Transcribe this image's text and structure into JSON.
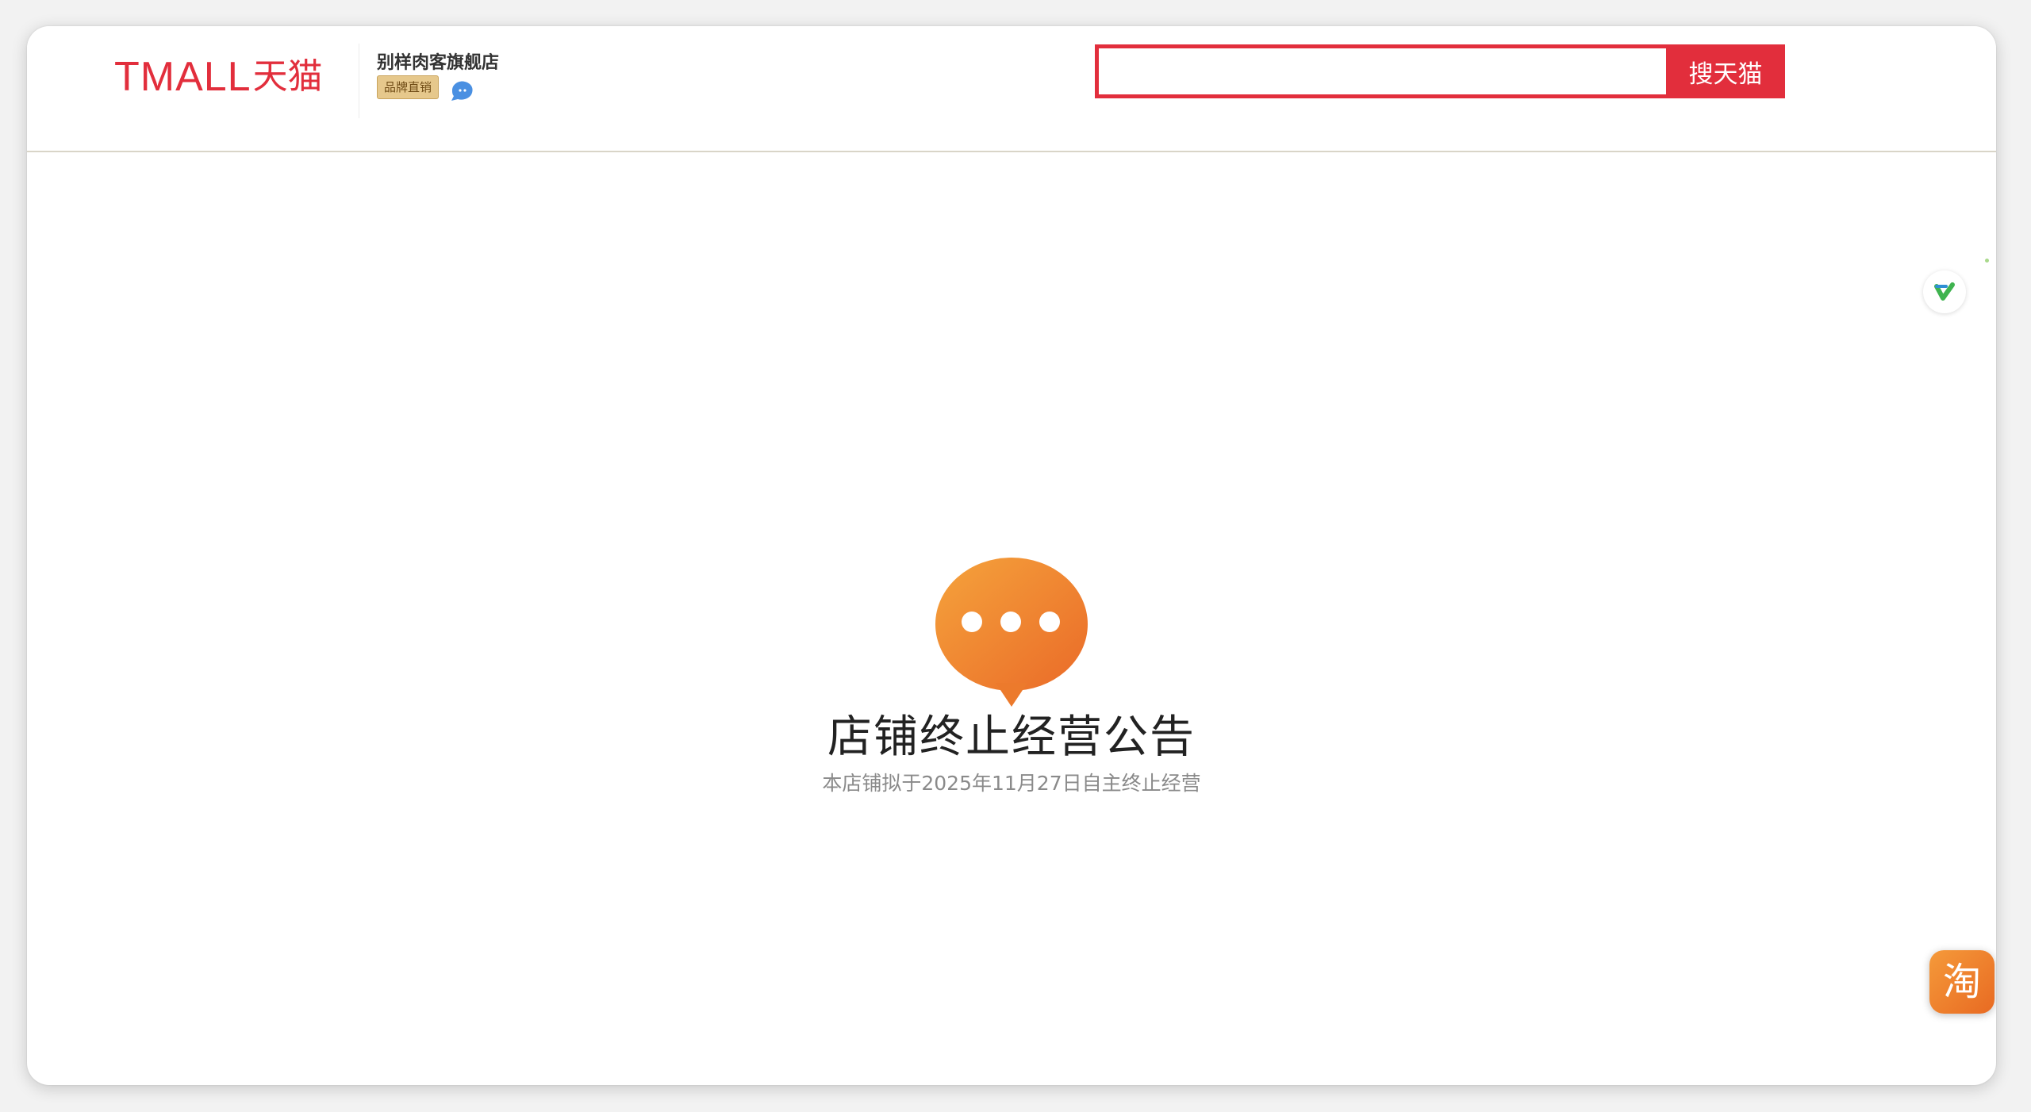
{
  "header": {
    "logo_text": "TMALL",
    "logo_cn": "天猫",
    "shop_name": "别样肉客旗舰店",
    "brand_badge": "品牌直销"
  },
  "search": {
    "value": "",
    "placeholder": "",
    "button_label": "搜天猫"
  },
  "notice": {
    "title": "店铺终止经营公告",
    "subtitle": "本店铺拟于2025年11月27日自主终止经营"
  },
  "float_buttons": {
    "taobao_label": "淘"
  },
  "colors": {
    "brand_red": "#e22e3c",
    "bubble_orange": "#f08a2e",
    "badge_gold": "#e6c88c",
    "taobao_orange": "#f59a3a"
  },
  "icons": {
    "shop_contact": "wangwang-chat-icon",
    "notice": "chat-bubble-icon",
    "floating": "v-check-icon"
  }
}
